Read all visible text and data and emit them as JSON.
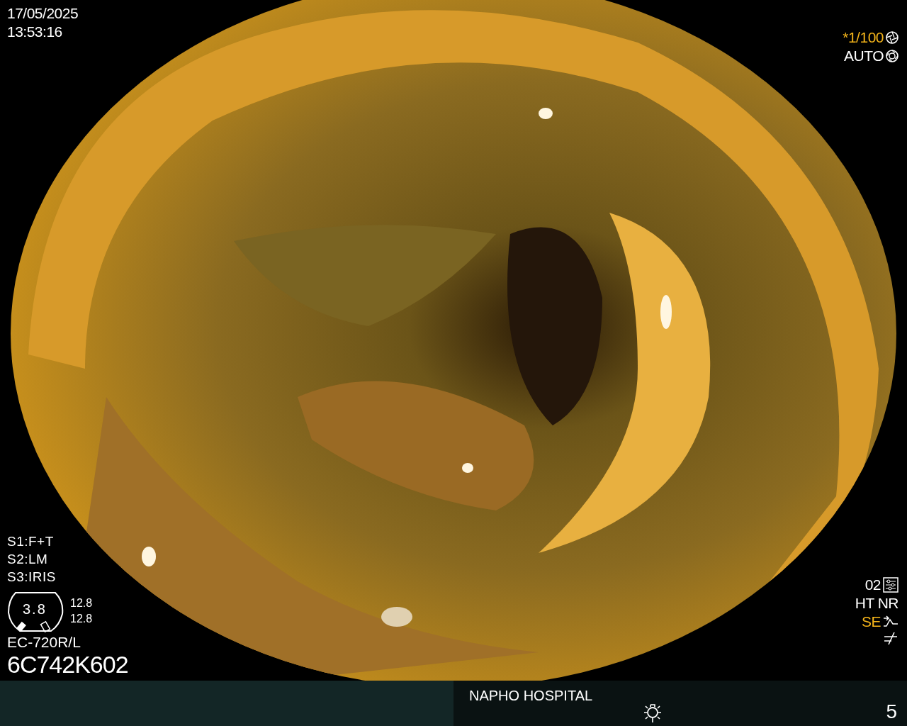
{
  "overlay": {
    "date": "17/05/2025",
    "time": "13:53:16",
    "shutter": "*1/100",
    "exposure_mode": "AUTO",
    "switches": [
      "S1:F+T",
      "S2:LM",
      "S3:IRIS"
    ],
    "gauge": {
      "value": "3.8",
      "readings": [
        "12.8",
        "12.8"
      ]
    },
    "scope_model": "EC-720R/L",
    "scope_serial": "6C742K602",
    "preset": "02",
    "modes": "HT NR",
    "enhancement": "SE"
  },
  "status_bar": {
    "hospital": "NAPHO HOSPITAL",
    "page": "5"
  }
}
